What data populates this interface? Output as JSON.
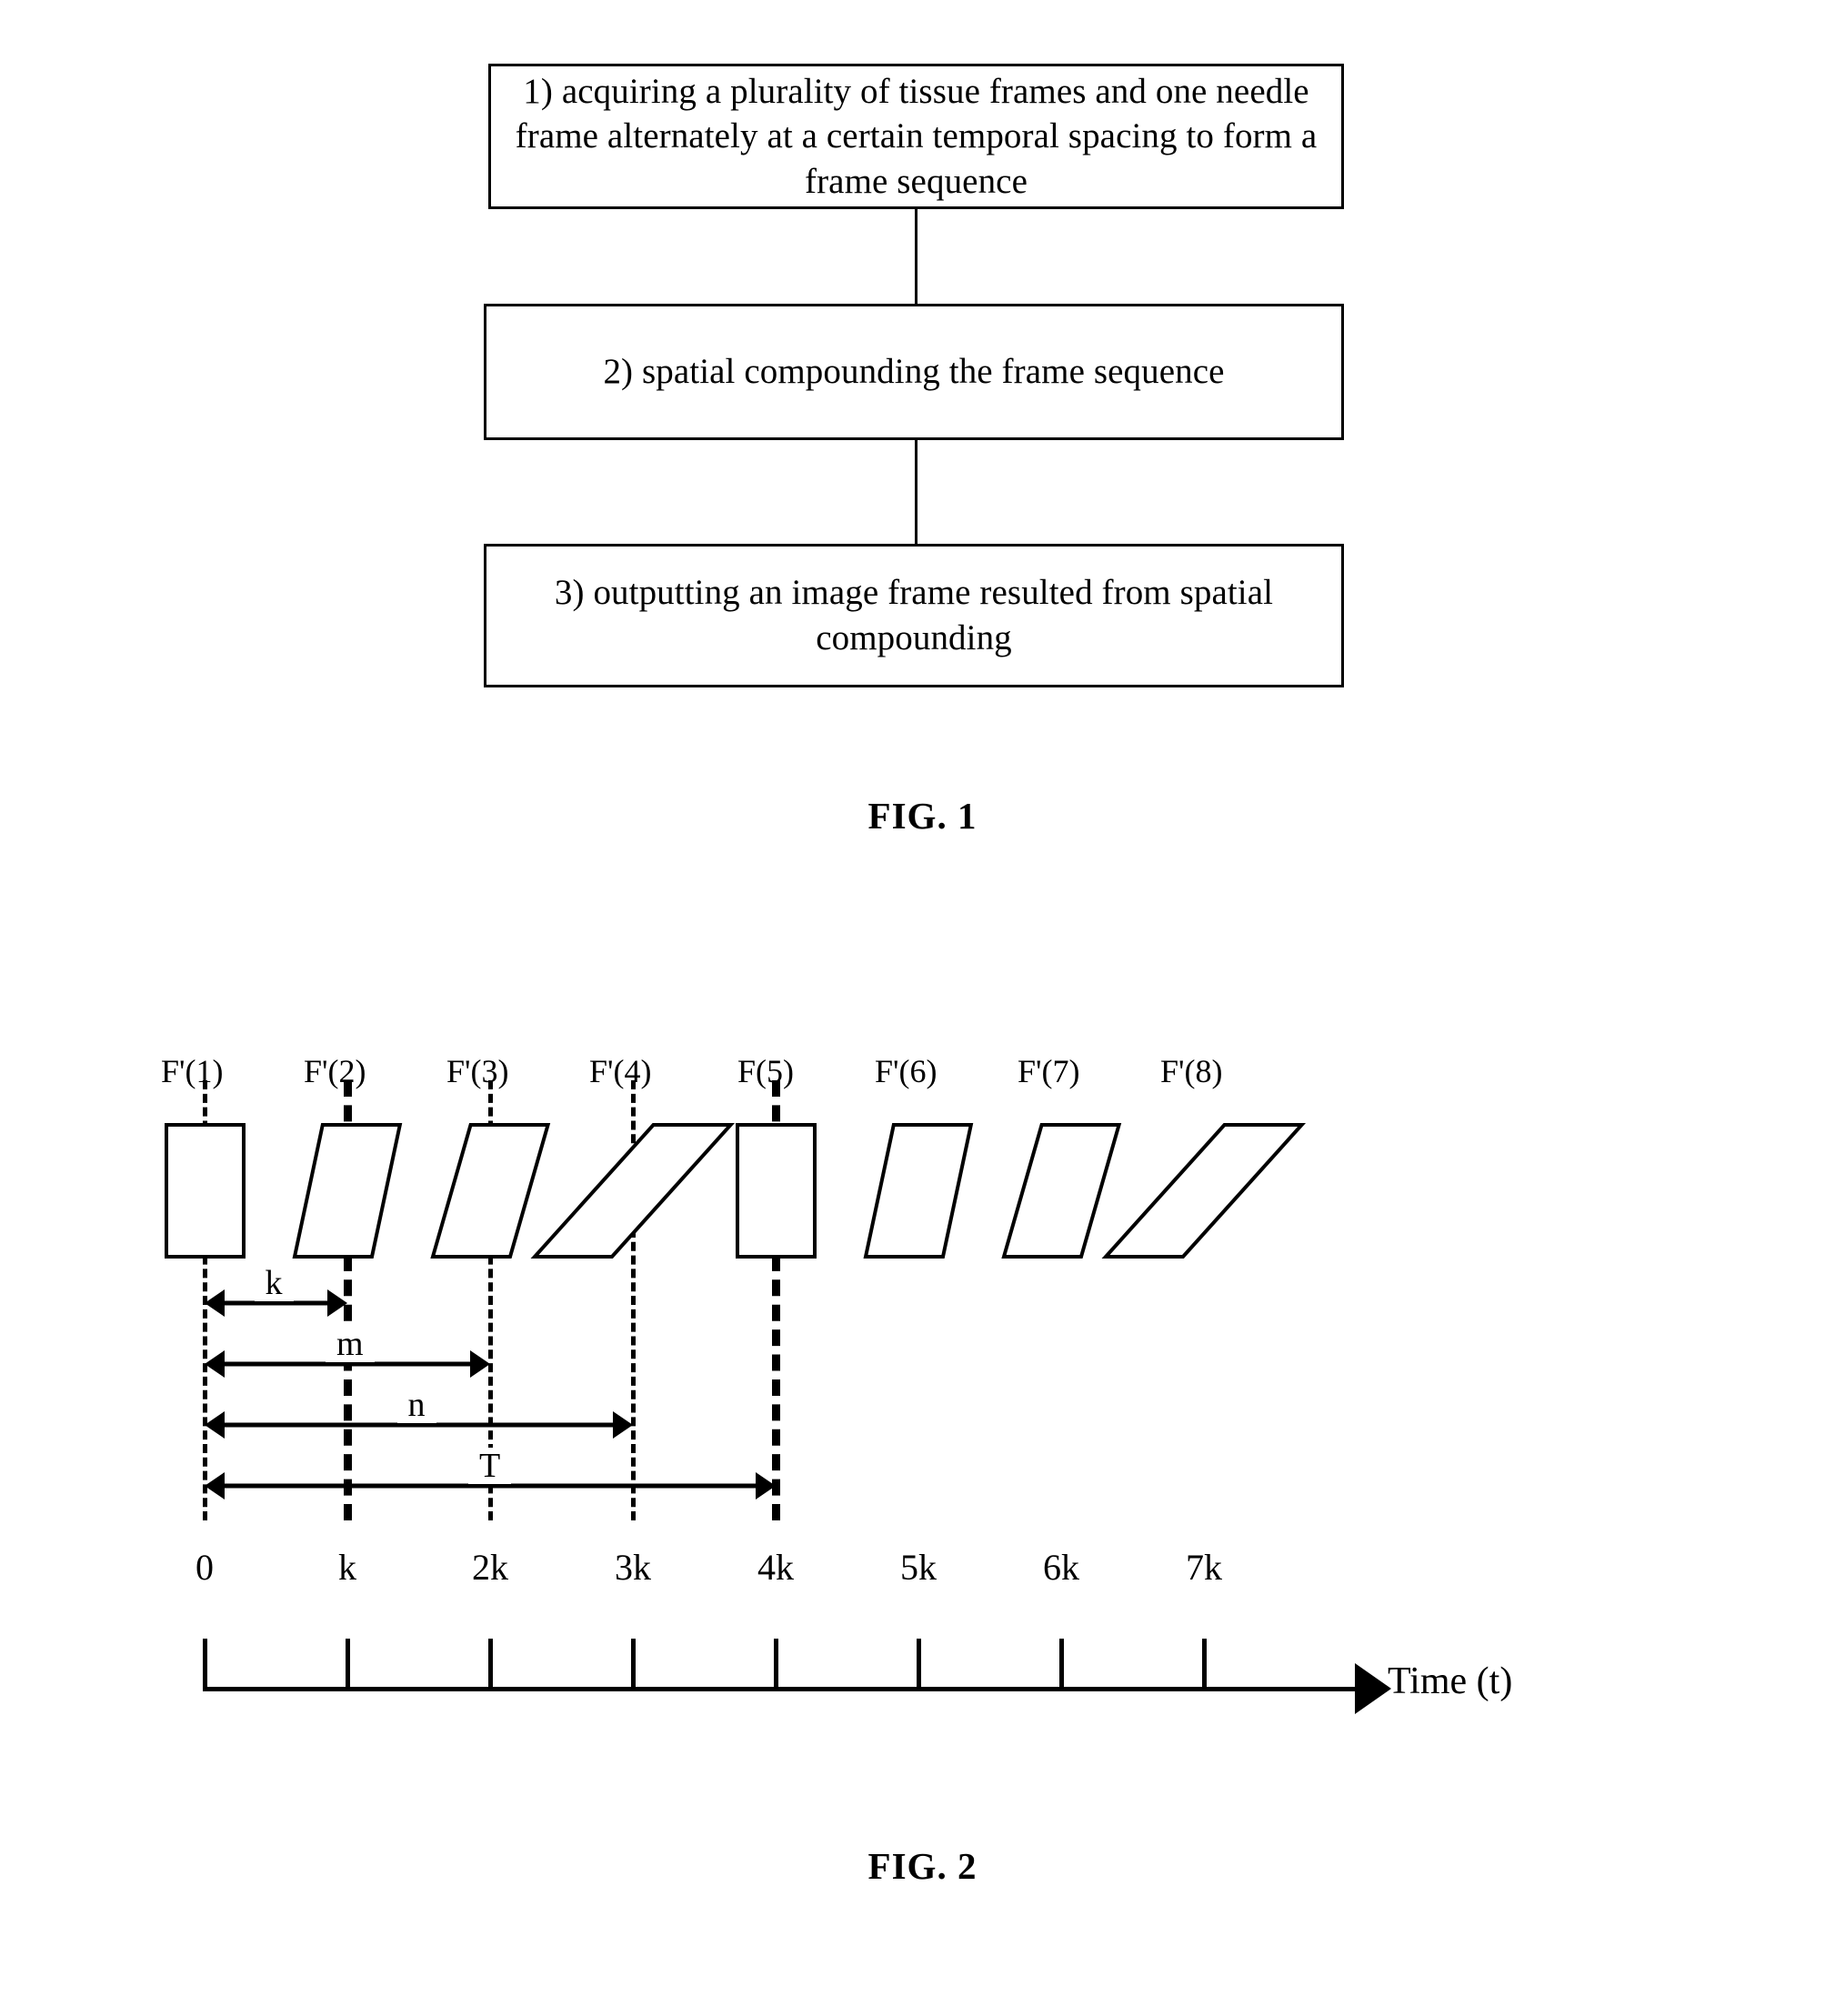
{
  "figure1": {
    "caption": "FIG. 1",
    "steps": [
      "1) acquiring a plurality of tissue frames and one needle frame alternately at a certain temporal spacing to form a frame sequence",
      "2) spatial compounding the frame sequence",
      "3) outputting an image frame resulted from spatial compounding"
    ]
  },
  "figure2": {
    "caption": "FIG. 2",
    "frame_labels": [
      "F'(1)",
      "F'(2)",
      "F'(3)",
      "F'(4)",
      "F(5)",
      "F'(6)",
      "F'(7)",
      "F'(8)"
    ],
    "axis_label": "Time (t)",
    "tick_labels": [
      "0",
      "k",
      "2k",
      "3k",
      "4k",
      "5k",
      "6k",
      "7k"
    ],
    "interval_labels": [
      "k",
      "m",
      "n",
      "T"
    ],
    "line_color": "#000000"
  },
  "chart_data": {
    "type": "timing-diagram",
    "title": "FIG. 2",
    "xlabel": "Time (t)",
    "x_ticks": [
      "0",
      "k",
      "2k",
      "3k",
      "4k",
      "5k",
      "6k",
      "7k"
    ],
    "x_tick_values": [
      0,
      1,
      2,
      3,
      4,
      5,
      6,
      7
    ],
    "frames": [
      {
        "label": "F'(1)",
        "t": 0,
        "type": "needle",
        "skew_deg": 0,
        "guide": "thin"
      },
      {
        "label": "F'(2)",
        "t": 1,
        "type": "tissue",
        "skew_deg": 12,
        "guide": "thick"
      },
      {
        "label": "F'(3)",
        "t": 2,
        "type": "tissue",
        "skew_deg": 16,
        "guide": "thin"
      },
      {
        "label": "F'(4)",
        "t": 3,
        "type": "tissue",
        "skew_deg": 42,
        "guide": "thin"
      },
      {
        "label": "F(5)",
        "t": 4,
        "type": "needle",
        "skew_deg": 0,
        "guide": "thick"
      },
      {
        "label": "F'(6)",
        "t": 5,
        "type": "tissue",
        "skew_deg": 12,
        "guide": "none"
      },
      {
        "label": "F'(7)",
        "t": 6,
        "type": "tissue",
        "skew_deg": 16,
        "guide": "none"
      },
      {
        "label": "F'(8)",
        "t": 7,
        "type": "tissue",
        "skew_deg": 42,
        "guide": "none"
      }
    ],
    "intervals": [
      {
        "label": "k",
        "from_t": 0,
        "to_t": 1
      },
      {
        "label": "m",
        "from_t": 0,
        "to_t": 2
      },
      {
        "label": "n",
        "from_t": 0,
        "to_t": 3
      },
      {
        "label": "T",
        "from_t": 0,
        "to_t": 4
      }
    ],
    "grid": false,
    "legend": "none"
  }
}
